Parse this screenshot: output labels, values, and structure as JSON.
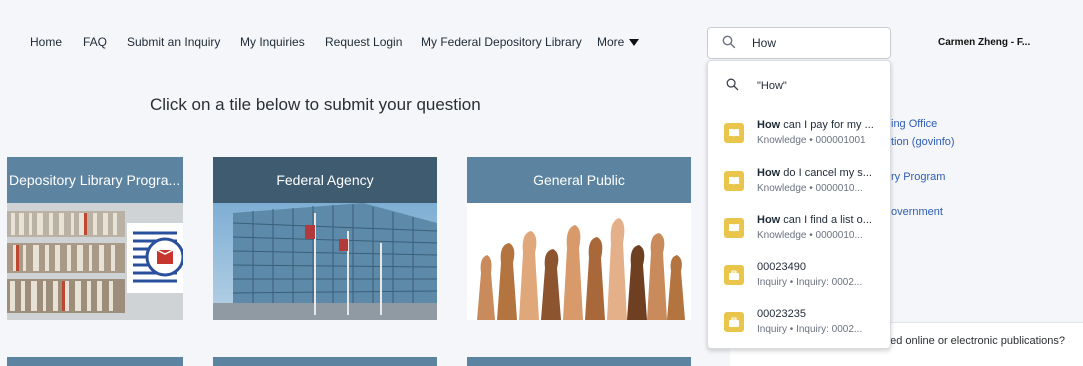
{
  "nav": {
    "items": [
      {
        "label": "Home"
      },
      {
        "label": "FAQ"
      },
      {
        "label": "Submit an Inquiry"
      },
      {
        "label": "My Inquiries"
      },
      {
        "label": "Request Login"
      },
      {
        "label": "My Federal Depository Library"
      },
      {
        "label": "More"
      }
    ],
    "search_value": "How",
    "user_name": "Carmen Zheng - F..."
  },
  "main": {
    "prompt": "Click on a tile below to submit your question",
    "tiles": [
      {
        "label": "Depository Library Progra..."
      },
      {
        "label": "Federal Agency"
      },
      {
        "label": "General Public"
      }
    ],
    "side_links": [
      "ing Office",
      "tion (govinfo)",
      "ry Program",
      "overnment"
    ],
    "faq_text": "ged online or electronic publications?"
  },
  "search_dropdown": {
    "query_text": "\"How\"",
    "results": [
      {
        "bold": "How",
        "rest": " can I pay for my ...",
        "sub": "Knowledge • 000001001"
      },
      {
        "bold": "How",
        "rest": " do I cancel my s...",
        "sub": "Knowledge • 0000010..."
      },
      {
        "bold": "How",
        "rest": " can I find a list o...",
        "sub": "Knowledge • 0000010..."
      },
      {
        "bold": "",
        "rest": "00023490",
        "sub": "Inquiry • Inquiry: 0002..."
      },
      {
        "bold": "",
        "rest": "00023235",
        "sub": "Inquiry • Inquiry: 0002..."
      }
    ]
  },
  "colors": {
    "tile_header": "#5c83a0",
    "tile_header_active": "#3e5b70",
    "badge": "#e9c64b",
    "link": "#2f5db5"
  }
}
